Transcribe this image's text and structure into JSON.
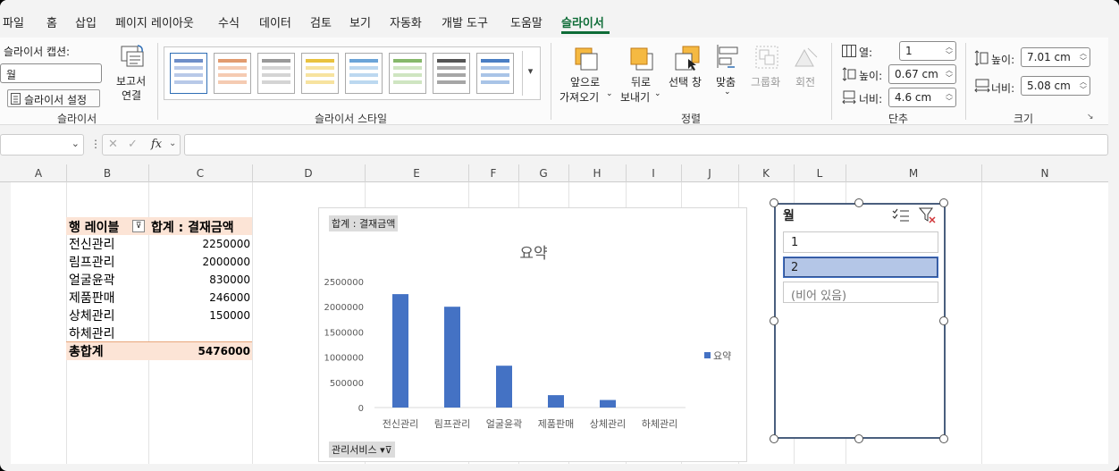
{
  "menu": {
    "items": [
      "파일",
      "홈",
      "삽입",
      "페이지 레이아웃",
      "수식",
      "데이터",
      "검토",
      "보기",
      "자동화",
      "개발 도구",
      "도움말",
      "슬라이서"
    ],
    "active": "슬라이서"
  },
  "ribbon": {
    "slicer_group": {
      "caption_label": "슬라이서 캡션:",
      "caption_value": "월",
      "settings_label": "슬라이서 설정",
      "report_label_1": "보고서",
      "report_label_2": "연결",
      "group_label": "슬라이서"
    },
    "styles_group": {
      "group_label": "슬라이서 스타일"
    },
    "arrange_group": {
      "bring_forward_1": "앞으로",
      "bring_forward_2": "가져오기",
      "send_backward_1": "뒤로",
      "send_backward_2": "보내기",
      "selection_pane": "선택 창",
      "align": "맞춤",
      "group": "그룹화",
      "rotate": "회전",
      "group_label": "정렬"
    },
    "buttons_group": {
      "columns_label": "열:",
      "columns_value": "1",
      "height_label": "높이:",
      "height_value": "0.67 cm",
      "width_label": "너비:",
      "width_value": "4.6 cm",
      "group_label": "단추"
    },
    "size_group": {
      "height_label": "높이:",
      "height_value": "7.01 cm",
      "width_label": "너비:",
      "width_value": "5.08 cm",
      "group_label": "크기"
    }
  },
  "formula_bar": {
    "fx": "fx",
    "value": ""
  },
  "columns": [
    "A",
    "B",
    "C",
    "D",
    "E",
    "F",
    "G",
    "H",
    "I",
    "J",
    "K",
    "L",
    "M",
    "N"
  ],
  "pivot": {
    "row_header": "행 레이블",
    "value_header": "합계 : 결재금액",
    "rows": [
      {
        "label": "전신관리",
        "value": "2250000"
      },
      {
        "label": "림프관리",
        "value": "2000000"
      },
      {
        "label": "얼굴윤곽",
        "value": "830000"
      },
      {
        "label": "제품판매",
        "value": "246000"
      },
      {
        "label": "상체관리",
        "value": "150000"
      },
      {
        "label": "하체관리",
        "value": ""
      }
    ],
    "total_label": "총합계",
    "total_value": "5476000"
  },
  "chart_meta": {
    "value_button": "합계 : 결재금액",
    "axis_button": "관리서비스"
  },
  "chart_data": {
    "type": "bar",
    "title": "요약",
    "categories": [
      "전신관리",
      "림프관리",
      "얼굴윤곽",
      "제품판매",
      "상체관리",
      "하체관리"
    ],
    "series": [
      {
        "name": "요약",
        "values": [
          2250000,
          2000000,
          830000,
          246000,
          150000,
          0
        ],
        "color": "#4472c4"
      }
    ],
    "yticks": [
      "0",
      "500000",
      "1000000",
      "1500000",
      "2000000",
      "2500000"
    ],
    "ylim": [
      0,
      2500000
    ],
    "legend": "right",
    "grid": false
  },
  "slicer": {
    "title": "월",
    "items": [
      {
        "label": "1",
        "selected": false
      },
      {
        "label": "2",
        "selected": true
      },
      {
        "label": "(비어 있음)",
        "selected": false
      }
    ]
  }
}
